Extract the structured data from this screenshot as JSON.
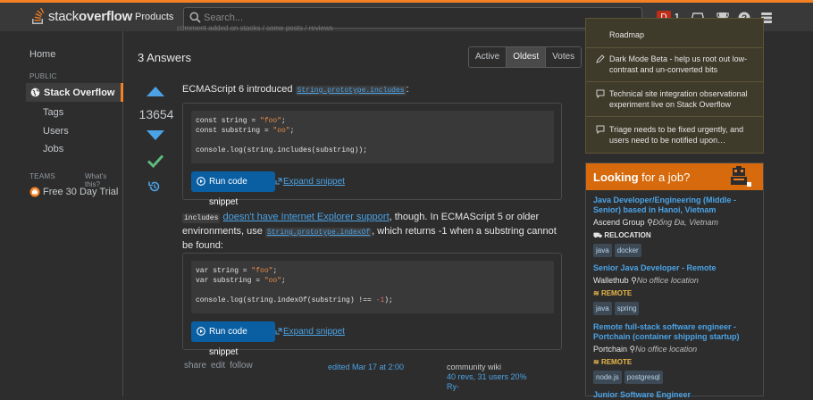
{
  "topbar": {
    "logo_prefix": "stack",
    "logo_bold": "overflow",
    "products": "Products",
    "search_placeholder": "Search...",
    "avatar_letter": "D",
    "reputation": "1",
    "accent": "#f48024"
  },
  "nav": {
    "home": "Home",
    "public_header": "PUBLIC",
    "stackoverflow": "Stack Overflow",
    "tags": "Tags",
    "users": "Users",
    "jobs": "Jobs",
    "teams_header": "TEAMS",
    "whats_this": "What's this?",
    "free_trial": "Free 30 Day Trial"
  },
  "main": {
    "cut_text": "comment added on stacks / some posts / reviews",
    "answers_heading": "3 Answers",
    "sort_tabs": [
      "Active",
      "Oldest",
      "Votes"
    ],
    "active_tab": "Oldest",
    "score": "13654",
    "p1_prefix": "ECMAScript 6 introduced ",
    "p1_code": "String.prototype.includes",
    "p1_suffix": ":",
    "code1": {
      "l1_a": "const string = ",
      "l1_s": "\"foo\"",
      "l1_b": ";",
      "l2_a": "const substring = ",
      "l2_s": "\"oo\"",
      "l2_b": ";",
      "l3": "console.log(string.includes(substring));"
    },
    "p2_code": "includes",
    "p2_link": "doesn't have Internet Explorer support",
    "p2_mid": ", though. In ECMAScript 5 or older environments, use ",
    "p2_code2": "String.prototype.indexOf",
    "p2_end": ", which returns -1 when a substring cannot be found:",
    "code2": {
      "l1_a": "var string = ",
      "l1_s": "\"foo\"",
      "l1_b": ";",
      "l2_a": "var substring = ",
      "l2_s": "\"oo\"",
      "l2_b": ";",
      "l3_a": "console.log(string.indexOf(substring) !== ",
      "l3_n": "-1",
      "l3_b": ");"
    },
    "run_label": "Run code snippet",
    "expand_label": "Expand snippet",
    "menu": {
      "share": "share",
      "edit": "edit",
      "follow": "follow"
    },
    "edited": "edited Mar 17 at 2:00",
    "wiki_label": "community wiki",
    "wiki_revs": "40 revs, 31 users 20%",
    "wiki_user": "Ry-"
  },
  "sidebar": {
    "item0": "Roadmap",
    "item1": "Dark Mode Beta - help us root out low-contrast and un-converted bits",
    "item2": "Technical site integration observational experiment live on Stack Overflow",
    "item3": "Triage needs to be fixed urgently, and users need to be notified upon…"
  },
  "jobs": {
    "title_bold": "Looking",
    "title_rest": " for a job?",
    "list": [
      {
        "title": "Java Developer/Engineering (Middle - Senior) based in Hanoi, Vietnam",
        "company": "Ascend Group",
        "location": "Đống Đa, Vietnam",
        "flag": "RELOCATION",
        "tags": [
          "java",
          "docker"
        ]
      },
      {
        "title": "Senior Java Developer - Remote",
        "company": "Wallethub",
        "location": "No office location",
        "flag": "REMOTE",
        "tags": [
          "java",
          "spring"
        ]
      },
      {
        "title": "Remote full-stack software engineer - Portchain (container shipping startup)",
        "company": "Portchain",
        "location": "No office location",
        "flag": "REMOTE",
        "tags": [
          "node.js",
          "postgresql"
        ]
      },
      {
        "title": "Junior Software Engineer"
      }
    ]
  }
}
